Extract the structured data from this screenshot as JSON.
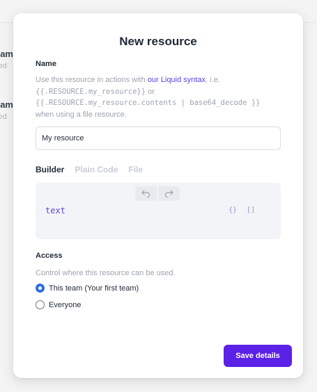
{
  "background": {
    "rows": [
      {
        "title": "Team",
        "subtitle": "used"
      },
      {
        "title": "Team",
        "subtitle": "used"
      }
    ]
  },
  "modal": {
    "title": "New resource",
    "name_section": {
      "label": "Name",
      "help_prefix": "Use this resource in actions with ",
      "help_link": "our Liquid syntax",
      "help_mid": ", i.e.",
      "example_1": "{{.RESOURCE.my_resource}}",
      "help_or": " or",
      "example_2": "{{.RESOURCE.my_resource.contents | base64_decode }}",
      "help_suffix": "when using a file resource.",
      "input_value": "My resource"
    },
    "tabs": [
      {
        "label": "Builder",
        "active": true
      },
      {
        "label": "Plain Code",
        "active": false
      },
      {
        "label": "File",
        "active": false
      }
    ],
    "editor": {
      "content": "text",
      "undo_icon": "undo-icon",
      "redo_icon": "redo-icon",
      "object_tool": "{}",
      "array_tool": "[]"
    },
    "access": {
      "label": "Access",
      "help": "Control where this resource can be used.",
      "options": [
        {
          "label": "This team (Your first team)",
          "checked": true
        },
        {
          "label": "Everyone",
          "checked": false
        }
      ]
    },
    "save_label": "Save details"
  },
  "colors": {
    "accent": "#5b21e6",
    "link": "#5b3ee6",
    "radio_checked": "#2f6fe0"
  }
}
